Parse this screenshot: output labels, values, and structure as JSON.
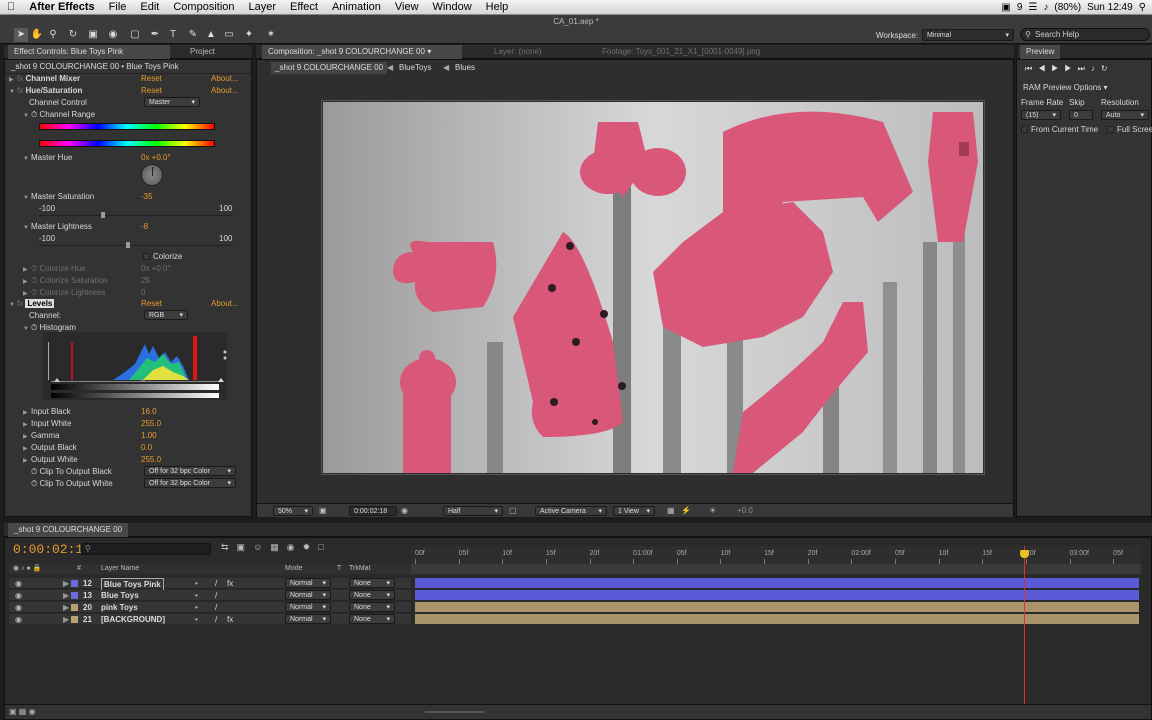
{
  "menubar": {
    "app_name": "After Effects",
    "items": [
      "File",
      "Edit",
      "Composition",
      "Layer",
      "Effect",
      "Animation",
      "View",
      "Window",
      "Help"
    ],
    "status": {
      "battery": "(80%)",
      "clock": "Sun 12:49",
      "badge": "9"
    }
  },
  "window_title": "CA_01.aep *",
  "toolbar": {
    "workspace_label": "Workspace:",
    "workspace_value": "Minimal",
    "search_placeholder": "Search Help"
  },
  "effect_controls": {
    "tab_label": "Effect Controls: Blue Toys Pink",
    "project_tab": "Project",
    "breadcrumb": "_shot 9 COLOURCHANGE 00 • Blue Toys Pink",
    "effects": [
      {
        "name": "Channel Mixer",
        "reset": "Reset",
        "about": "About..."
      },
      {
        "name": "Hue/Saturation",
        "reset": "Reset",
        "about": "About..."
      }
    ],
    "channel_control_label": "Channel Control",
    "channel_control_value": "Master",
    "channel_range_label": "Channel Range",
    "master_hue_label": "Master Hue",
    "master_hue_value": "0x +0.0°",
    "master_saturation_label": "Master Saturation",
    "master_saturation_value": "-35",
    "sat_min": "-100",
    "sat_max": "100",
    "master_lightness_label": "Master Lightness",
    "master_lightness_value": "-8",
    "light_min": "-100",
    "light_max": "100",
    "colorize_label": "Colorize",
    "colorize_hue_label": "Colorize Hue",
    "colorize_hue_value": "0x +0.0°",
    "colorize_sat_label": "Colorize Saturation",
    "colorize_sat_value": "25",
    "colorize_light_label": "Colorize Lightness",
    "colorize_light_value": "0",
    "levels": {
      "name": "Levels",
      "reset": "Reset",
      "about": "About...",
      "channel_label": "Channel:",
      "channel_value": "RGB",
      "histogram_label": "Histogram",
      "params": [
        {
          "label": "Input Black",
          "value": "16.0"
        },
        {
          "label": "Input White",
          "value": "255.0"
        },
        {
          "label": "Gamma",
          "value": "1.00"
        },
        {
          "label": "Output Black",
          "value": "0.0"
        },
        {
          "label": "Output White",
          "value": "255.0"
        }
      ],
      "clip_black_label": "Clip To Output Black",
      "clip_black_value": "Off for 32 bpc Color",
      "clip_white_label": "Clip To Output White",
      "clip_white_value": "Off for 32 bpc Color"
    }
  },
  "composition": {
    "tab_label": "Composition: _shot 9 COLOURCHANGE 00",
    "layer_tab": "Layer: (none)",
    "footage_tab": "Footage: Toys_001_21_X1_[0001-0049].png",
    "flowchart": [
      "_shot 9 COLOURCHANGE 00",
      "BlueToys",
      "Blues"
    ],
    "viewer_footer": {
      "zoom": "50%",
      "timecode": "0:00:02:18",
      "resolution": "Half",
      "camera": "Active Camera",
      "views": "1 View",
      "exposure": "+0.0"
    }
  },
  "preview": {
    "tab_label": "Preview",
    "ram_options": "RAM Preview Options",
    "frame_rate_label": "Frame Rate",
    "skip_label": "Skip",
    "resolution_label": "Resolution",
    "frame_rate_value": "(15)",
    "skip_value": "0",
    "resolution_value": "Auto",
    "from_current_label": "From Current Time",
    "full_screen_label": "Full Screen"
  },
  "timeline": {
    "tab_label": "_shot 9 COLOURCHANGE 00",
    "timecode": "0:00:02:18",
    "columns": {
      "num": "#",
      "layer_name": "Layer Name",
      "mode": "Mode",
      "t": "T",
      "trkmat": "TrkMat"
    },
    "ruler": [
      "00f",
      "05f",
      "10f",
      "15f",
      "20f",
      "01:00f",
      "05f",
      "10f",
      "15f",
      "20f",
      "02:00f",
      "05f",
      "10f",
      "15f",
      "20f",
      "03:00f",
      "05f"
    ],
    "playhead_fraction": 0.84,
    "layers": [
      {
        "num": "12",
        "name": "Blue Toys Pink",
        "mode": "Normal",
        "trkmat": "None",
        "color": "#6a6ad8",
        "fx": "fx",
        "bar": "#5a5ad6"
      },
      {
        "num": "13",
        "name": "Blue Toys",
        "mode": "Normal",
        "trkmat": "None",
        "color": "#6a6ad8",
        "fx": "",
        "bar": "#5a5ad6"
      },
      {
        "num": "20",
        "name": "pink Toys",
        "mode": "Normal",
        "trkmat": "None",
        "color": "#b8a070",
        "fx": "",
        "bar": "#a8936a"
      },
      {
        "num": "21",
        "name": "[BACKGROUND]",
        "mode": "Normal",
        "trkmat": "None",
        "color": "#b8a070",
        "fx": "fx",
        "bar": "#a8936a"
      }
    ]
  },
  "colors": {
    "accent": "#e89b2a",
    "pink": "#d9587a",
    "panel": "#333333"
  }
}
